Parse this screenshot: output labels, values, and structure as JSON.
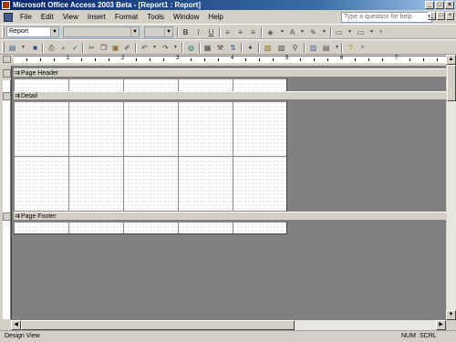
{
  "window": {
    "title": "Microsoft Office Access 2003 Beta - [Report1 : Report]",
    "controls": [
      "_",
      "□",
      "×"
    ]
  },
  "menubar": {
    "items": [
      "File",
      "Edit",
      "View",
      "Insert",
      "Format",
      "Tools",
      "Window",
      "Help"
    ],
    "help_placeholder": "Type a question for help",
    "doc_controls": [
      "_",
      "□",
      "×"
    ]
  },
  "format_toolbar": {
    "object_selector": "Report",
    "font_name": "",
    "font_size": "",
    "style_buttons": [
      "B",
      "I",
      "U"
    ]
  },
  "sections": {
    "page_header": "Page Header",
    "detail": "Detail",
    "page_footer": "Page Footer"
  },
  "ruler": {
    "numbers": [
      "1",
      "2",
      "3",
      "4",
      "5",
      "6",
      "7"
    ]
  },
  "statusbar": {
    "mode": "Design View",
    "num": "NUM",
    "scrl": "SCRL"
  },
  "colors": {
    "title_start": "#0a246a",
    "title_end": "#a6caf0",
    "face": "#d4d0c8",
    "workspace": "#808080"
  },
  "icons": {
    "toolbar1": [
      "align-left-icon",
      "align-center-icon",
      "align-right-icon",
      "fill-color-icon",
      "font-color-icon",
      "line-color-icon",
      "line-width-icon",
      "special-effect-icon"
    ],
    "toolbar2": [
      "view-icon",
      "save-icon",
      "print-icon",
      "print-preview-icon",
      "spelling-icon",
      "cut-icon",
      "copy-icon",
      "paste-icon",
      "format-painter-icon",
      "undo-icon",
      "redo-icon",
      "hyperlink-icon",
      "field-list-icon",
      "toolbox-icon",
      "sorting-grouping-icon",
      "autoformat-icon",
      "code-icon",
      "properties-icon",
      "build-icon",
      "database-window-icon",
      "new-object-icon",
      "help-icon"
    ]
  }
}
